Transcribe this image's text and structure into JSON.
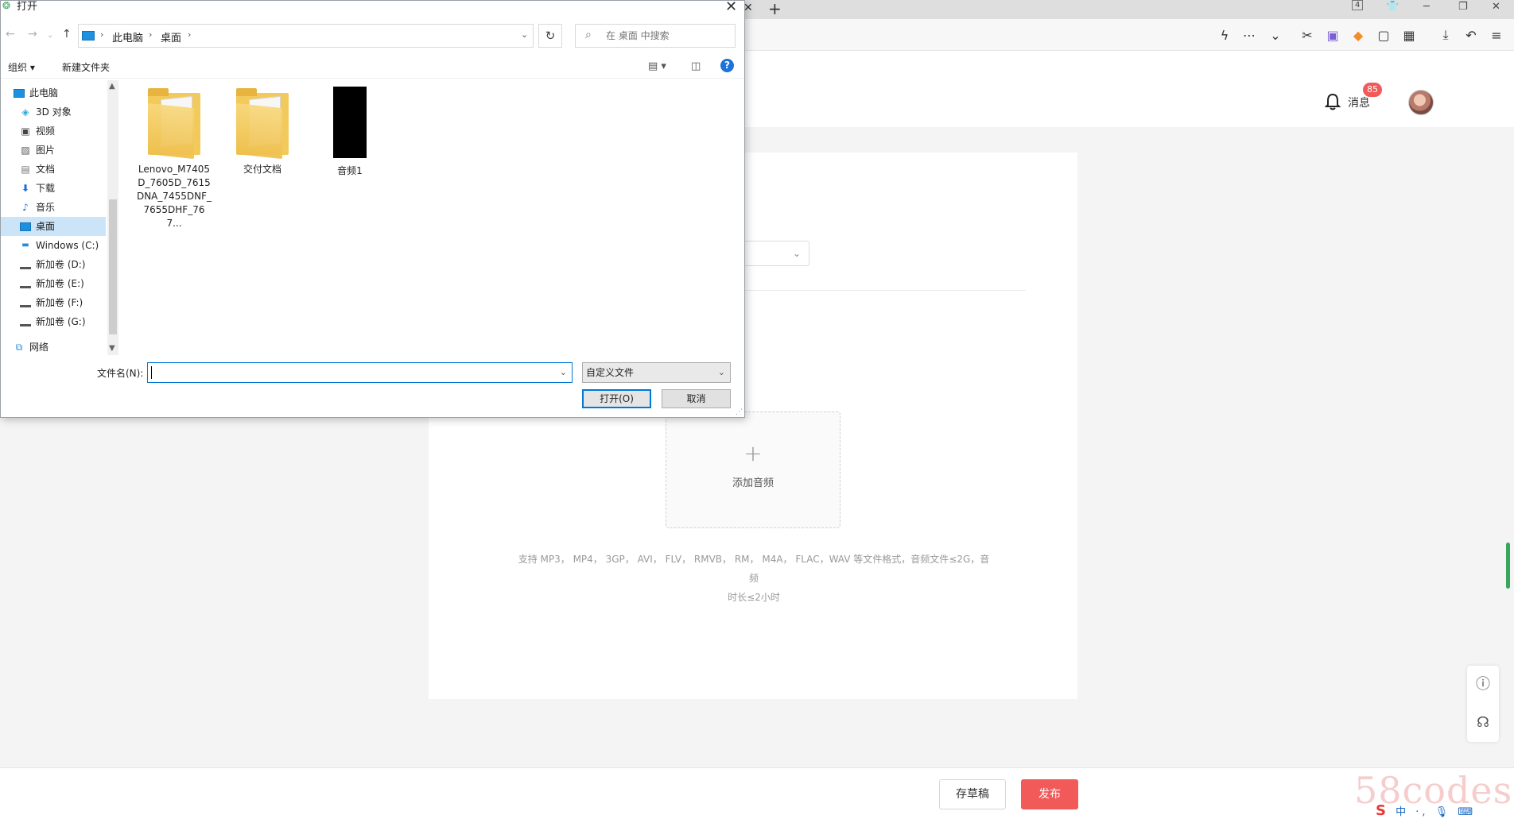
{
  "browser": {
    "tab_badge": "4",
    "icons": [
      "lightning-icon",
      "more-icon",
      "chevron-down-icon",
      "scissors-icon",
      "reader-icon",
      "game-icon",
      "screenshot-icon",
      "apps-icon",
      "download-icon",
      "undo-icon",
      "menu-icon"
    ],
    "messages_label": "消息",
    "messages_badge": "85"
  },
  "page": {
    "upload_label": "添加音频",
    "formats_line1": "支持 MP3， MP4， 3GP， AVI， FLV， RMVB， RM， M4A， FLAC，WAV 等文件格式，音频文件≤2G，音频",
    "formats_line2": "时长≤2小时",
    "save_draft": "存草稿",
    "publish": "发布",
    "watermark": "58codes",
    "tray_text": "中 ·,"
  },
  "dialog": {
    "title": "打开",
    "breadcrumb": [
      "此电脑",
      "桌面"
    ],
    "search_placeholder": "在 桌面 中搜索",
    "organize": "组织 ▾",
    "new_folder": "新建文件夹",
    "nav_items": [
      {
        "label": "此电脑",
        "icon": "computer-icon"
      },
      {
        "label": "3D 对象",
        "icon": "cube-icon"
      },
      {
        "label": "视频",
        "icon": "video-icon"
      },
      {
        "label": "图片",
        "icon": "picture-icon"
      },
      {
        "label": "文档",
        "icon": "document-icon"
      },
      {
        "label": "下载",
        "icon": "download-arrow-icon"
      },
      {
        "label": "音乐",
        "icon": "music-icon"
      },
      {
        "label": "桌面",
        "icon": "desktop-icon"
      },
      {
        "label": "Windows (C:)",
        "icon": "drive-icon"
      },
      {
        "label": "新加卷 (D:)",
        "icon": "drive-icon"
      },
      {
        "label": "新加卷 (E:)",
        "icon": "drive-icon"
      },
      {
        "label": "新加卷 (F:)",
        "icon": "drive-icon"
      },
      {
        "label": "新加卷 (G:)",
        "icon": "drive-icon"
      },
      {
        "label": "网络",
        "icon": "network-icon"
      }
    ],
    "selected_nav": "桌面",
    "files": [
      {
        "name": "Lenovo_M7405D_7605D_7615DNA_7455DNF_7655DHF_767...",
        "type": "folder"
      },
      {
        "name": "交付文档",
        "type": "folder"
      },
      {
        "name": "音频1",
        "type": "file"
      }
    ],
    "filename_label": "文件名(N):",
    "filename_value": "",
    "filetype_value": "自定义文件",
    "open_button": "打开(O)",
    "cancel_button": "取消"
  }
}
